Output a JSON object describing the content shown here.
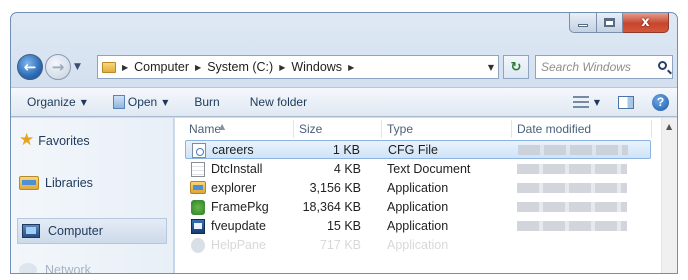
{
  "window": {
    "caption": {
      "min": "–",
      "max": "",
      "close": "x"
    }
  },
  "nav": {
    "back": "←",
    "forward": "→",
    "dropdown": "▼",
    "breadcrumb": [
      "Computer",
      "System (C:)",
      "Windows"
    ],
    "refresh": "↻",
    "search_placeholder": "Search Windows"
  },
  "toolbar": {
    "organize": "Organize",
    "open": "Open",
    "burn": "Burn",
    "new_folder": "New folder"
  },
  "sidebar": {
    "items": [
      {
        "label": "Favorites",
        "icon": "star-icon"
      },
      {
        "label": "Libraries",
        "icon": "libraries-icon"
      },
      {
        "label": "Computer",
        "icon": "computer-icon",
        "selected": true
      },
      {
        "label": "Network",
        "icon": "network-icon"
      }
    ]
  },
  "filelist": {
    "columns": [
      "Name",
      "Size",
      "Type",
      "Date modified"
    ],
    "rows": [
      {
        "name": "careers",
        "size": "1 KB",
        "type": "CFG File",
        "icon": "cfg-file-icon",
        "selected": true
      },
      {
        "name": "DtcInstall",
        "size": "4 KB",
        "type": "Text Document",
        "icon": "text-file-icon"
      },
      {
        "name": "explorer",
        "size": "3,156 KB",
        "type": "Application",
        "icon": "explorer-icon"
      },
      {
        "name": "FramePkg",
        "size": "18,364 KB",
        "type": "Application",
        "icon": "framepkg-icon"
      },
      {
        "name": "fveupdate",
        "size": "15 KB",
        "type": "Application",
        "icon": "fveupdate-icon"
      },
      {
        "name": "HelpPane",
        "size": "717 KB",
        "type": "Application",
        "icon": "helppane-icon"
      }
    ]
  }
}
